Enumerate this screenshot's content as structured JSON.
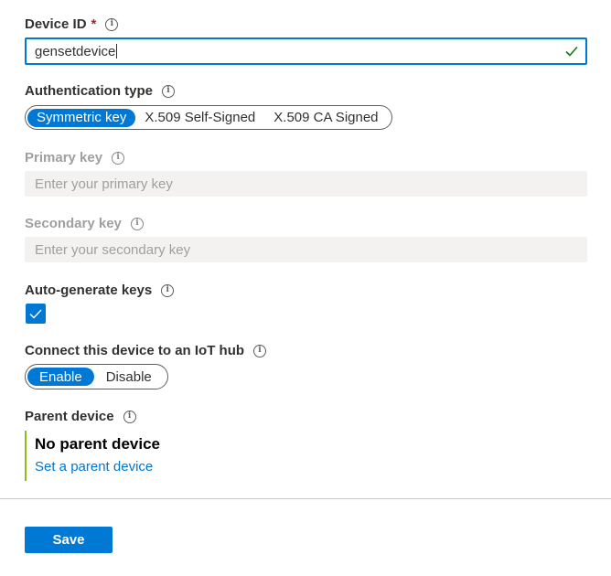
{
  "device_id": {
    "label": "Device ID",
    "required_mark": "*",
    "value": "gensetdevice",
    "valid_icon": "checkmark-icon"
  },
  "auth_type": {
    "label": "Authentication type",
    "options": [
      "Symmetric key",
      "X.509 Self-Signed",
      "X.509 CA Signed"
    ],
    "selected": "Symmetric key"
  },
  "primary_key": {
    "label": "Primary key",
    "placeholder": "Enter your primary key"
  },
  "secondary_key": {
    "label": "Secondary key",
    "placeholder": "Enter your secondary key"
  },
  "auto_generate": {
    "label": "Auto-generate keys",
    "checked": true
  },
  "connect_hub": {
    "label": "Connect this device to an IoT hub",
    "options": [
      "Enable",
      "Disable"
    ],
    "selected": "Enable"
  },
  "parent_device": {
    "label": "Parent device",
    "value": "No parent device",
    "link": "Set a parent device"
  },
  "actions": {
    "save_label": "Save"
  },
  "info_glyph": "i",
  "colors": {
    "accent": "#0078d4",
    "required": "#a4262c",
    "valid": "#107c10",
    "parent_bar": "#8cbd18"
  }
}
